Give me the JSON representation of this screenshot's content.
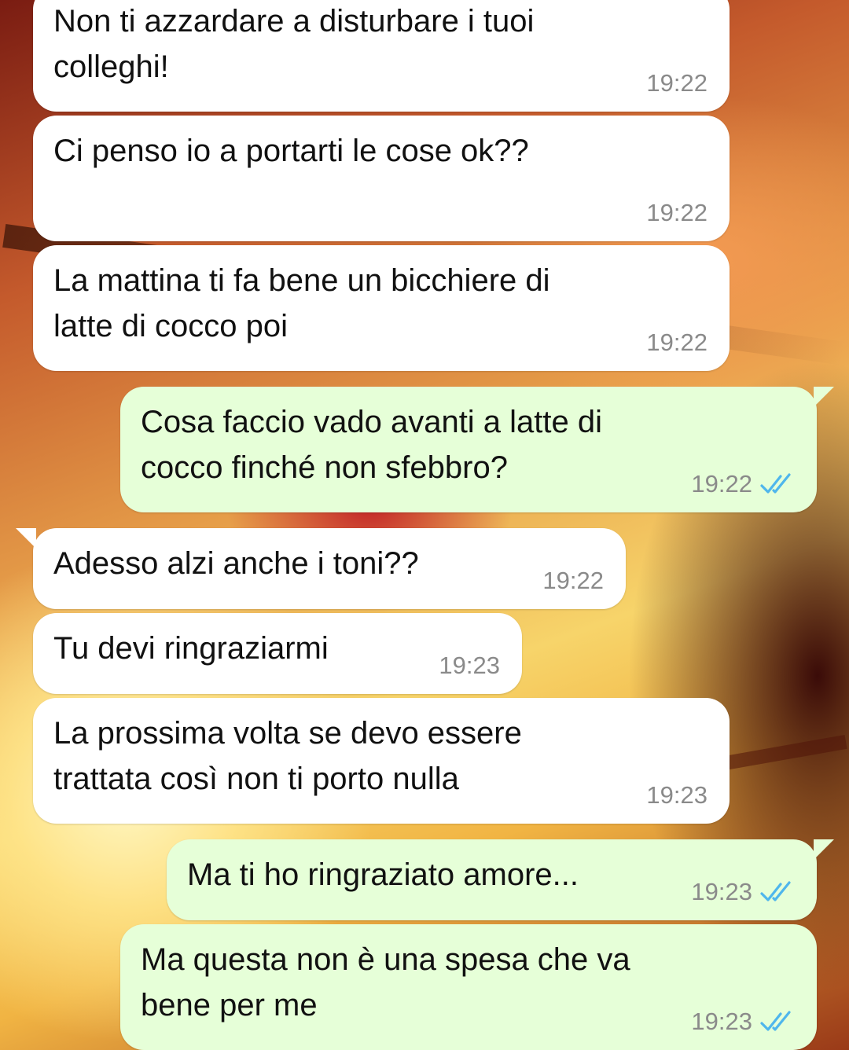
{
  "messages": [
    {
      "direction": "incoming",
      "text": "Non ti azzardare a disturbare i tuoi\ncolleghi!",
      "time": "19:22"
    },
    {
      "direction": "incoming",
      "text": "Ci penso io a portarti le cose ok??",
      "time": "19:22"
    },
    {
      "direction": "incoming",
      "text": "La mattina ti fa bene un bicchiere di\nlatte di cocco poi",
      "time": "19:22"
    },
    {
      "direction": "outgoing",
      "text": "Cosa faccio vado avanti a latte di\ncocco finché non sfebbro?",
      "time": "19:22",
      "status": "read-double-check-icon"
    },
    {
      "direction": "incoming",
      "text": "Adesso alzi anche i toni??",
      "time": "19:22"
    },
    {
      "direction": "incoming",
      "text": "Tu devi ringraziarmi",
      "time": "19:23"
    },
    {
      "direction": "incoming",
      "text": "La prossima volta se devo essere\ntrattata così non ti porto nulla",
      "time": "19:23"
    },
    {
      "direction": "outgoing",
      "text": "Ma ti ho ringraziato amore...",
      "time": "19:23",
      "status": "read-double-check-icon"
    },
    {
      "direction": "outgoing",
      "text": "Ma questa non è una spesa che va\nbene per me",
      "time": "19:23",
      "status": "read-double-check-icon"
    }
  ],
  "colors": {
    "incoming_bubble": "#ffffff",
    "outgoing_bubble": "#e6ffd8",
    "timestamp": "#8a8a8a",
    "read_ticks": "#4fb6ec"
  }
}
